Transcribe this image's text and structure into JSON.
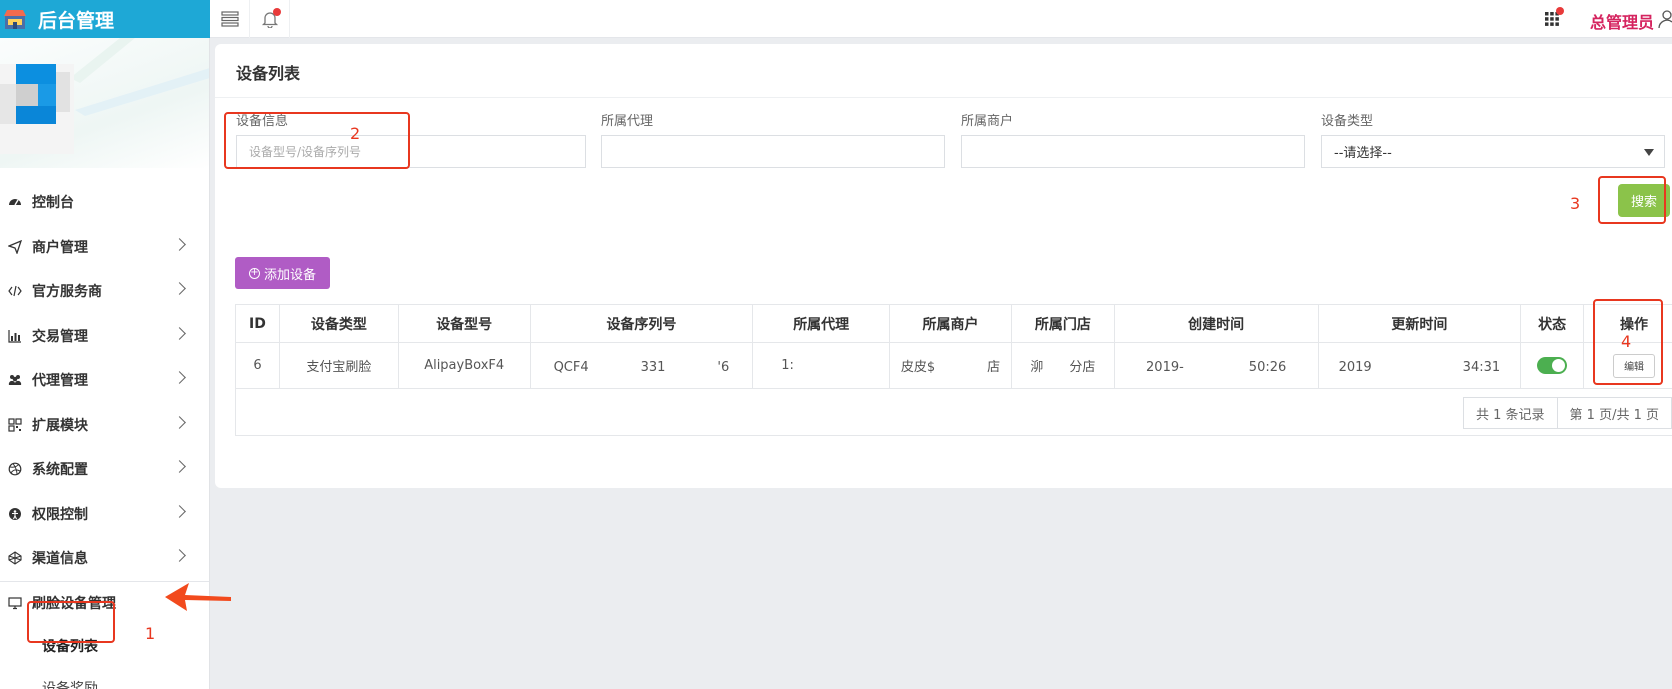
{
  "header": {
    "brand_title": "后台管理",
    "admin_name": "总管理员",
    "colors": {
      "brand_bg": "#1ea8d6",
      "admin_text": "#d5245f",
      "notification_dot": "#e83a3a"
    }
  },
  "sidebar": {
    "items": [
      {
        "label": "控制台",
        "icon": "dashboard-icon"
      },
      {
        "label": "商户管理",
        "icon": "send-icon"
      },
      {
        "label": "官方服务商",
        "icon": "code-icon"
      },
      {
        "label": "交易管理",
        "icon": "bar-chart-icon"
      },
      {
        "label": "代理管理",
        "icon": "users-icon"
      },
      {
        "label": "扩展模块",
        "icon": "qrcode-icon"
      },
      {
        "label": "系统配置",
        "icon": "dribbble-icon"
      },
      {
        "label": "权限控制",
        "icon": "shield-icon"
      },
      {
        "label": "渠道信息",
        "icon": "codepen-icon"
      }
    ],
    "open_item": {
      "label": "刷脸设备管理",
      "icon": "monitor-icon"
    },
    "sub_items": [
      {
        "label": "设备列表"
      },
      {
        "label": "设备奖励"
      }
    ]
  },
  "main": {
    "title": "设备列表",
    "filters": {
      "device_info_label": "设备信息",
      "device_info_placeholder": "设备型号/设备序列号",
      "agent_label": "所属代理",
      "merchant_label": "所属商户",
      "type_label": "设备类型",
      "type_selected": "--请选择--"
    },
    "search_button": "搜索",
    "add_button": "添加设备",
    "table": {
      "headers": [
        "ID",
        "设备类型",
        "设备型号",
        "设备序列号",
        "所属代理",
        "所属商户",
        "所属门店",
        "创建时间",
        "更新时间",
        "状态",
        "操作"
      ],
      "rows": [
        {
          "id": "6",
          "type": "支付宝刷脸",
          "model": "AlipayBoxF4",
          "serial": "QCF4　　　　331　　　　'6",
          "agent": "1:",
          "merchant": "皮皮$　　　　店",
          "store": "泖　　分店",
          "created": "2019-　　　　　50:26",
          "updated": "2019　　　　　　　34:31",
          "status_on": true,
          "edit_label": "编辑"
        }
      ],
      "pager_total": "共 1 条记录",
      "pager_page": "第 1 页/共 1 页"
    },
    "colors": {
      "search_bg": "#8bc34a",
      "add_bg": "#b05cc5",
      "toggle_on": "#4caf50"
    }
  },
  "annotations": {
    "labels": [
      "1",
      "2",
      "3",
      "4"
    ],
    "color": "#e8371f"
  }
}
